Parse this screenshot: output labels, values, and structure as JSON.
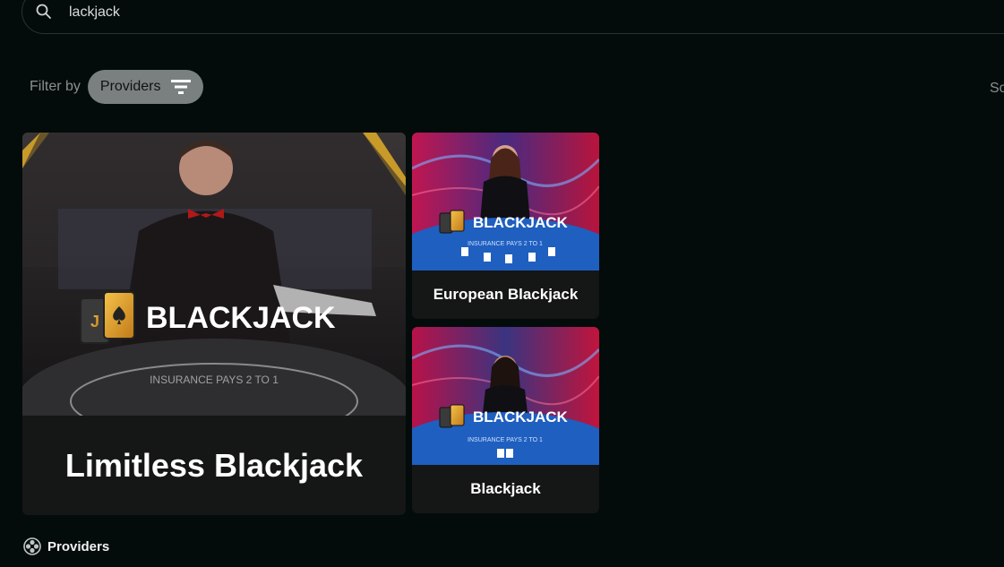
{
  "search": {
    "value": "lackjack",
    "icon": "search-icon"
  },
  "filter": {
    "label": "Filter by",
    "providers_button": "Providers",
    "icon": "filter-icon",
    "pill_color": "#7a8080"
  },
  "sort": {
    "label_partial": "So"
  },
  "games": [
    {
      "title": "Limitless Blackjack",
      "logo_text": "BLACKJACK"
    },
    {
      "title": "European Blackjack",
      "logo_text": "BLACKJACK"
    },
    {
      "title": "Blackjack",
      "logo_text": "BLACKJACK"
    }
  ],
  "footer": {
    "providers_label": "Providers",
    "icon": "providers-icon"
  },
  "colors": {
    "background": "#040b0b",
    "card": "#151616",
    "table_blue": "#1f5fbf",
    "gold": "#e0a030"
  }
}
